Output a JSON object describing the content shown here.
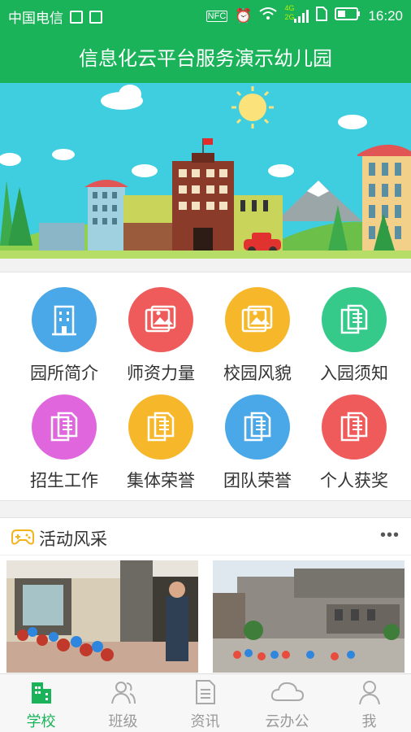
{
  "status_bar": {
    "carrier": "中国电信",
    "nfc": "NFC",
    "time": "16:20",
    "net_top": "4G",
    "net_bottom": "2G"
  },
  "header": {
    "title": "信息化云平台服务演示幼儿园"
  },
  "grid": [
    {
      "label": "园所简介",
      "icon": "building-icon",
      "color": "#4aa8e8"
    },
    {
      "label": "师资力量",
      "icon": "gallery-icon",
      "color": "#ef5a5a"
    },
    {
      "label": "校园风貌",
      "icon": "gallery-icon",
      "color": "#f6b72a"
    },
    {
      "label": "入园须知",
      "icon": "document-icon",
      "color": "#35c98a"
    },
    {
      "label": "招生工作",
      "icon": "document-icon",
      "color": "#e066de"
    },
    {
      "label": "集体荣誉",
      "icon": "document-icon",
      "color": "#f6b72a"
    },
    {
      "label": "团队荣誉",
      "icon": "document-icon",
      "color": "#4aa8e8"
    },
    {
      "label": "个人获奖",
      "icon": "document-icon",
      "color": "#ef5a5a"
    }
  ],
  "activity": {
    "title": "活动风采",
    "more": "•••"
  },
  "tabs": [
    {
      "label": "学校",
      "icon": "school-icon",
      "active": true
    },
    {
      "label": "班级",
      "icon": "users-icon",
      "active": false
    },
    {
      "label": "资讯",
      "icon": "news-icon",
      "active": false
    },
    {
      "label": "云办公",
      "icon": "cloud-icon",
      "active": false
    },
    {
      "label": "我",
      "icon": "person-icon",
      "active": false
    }
  ],
  "colors": {
    "brand": "#1ab35a",
    "sky": "#3fcde0"
  }
}
